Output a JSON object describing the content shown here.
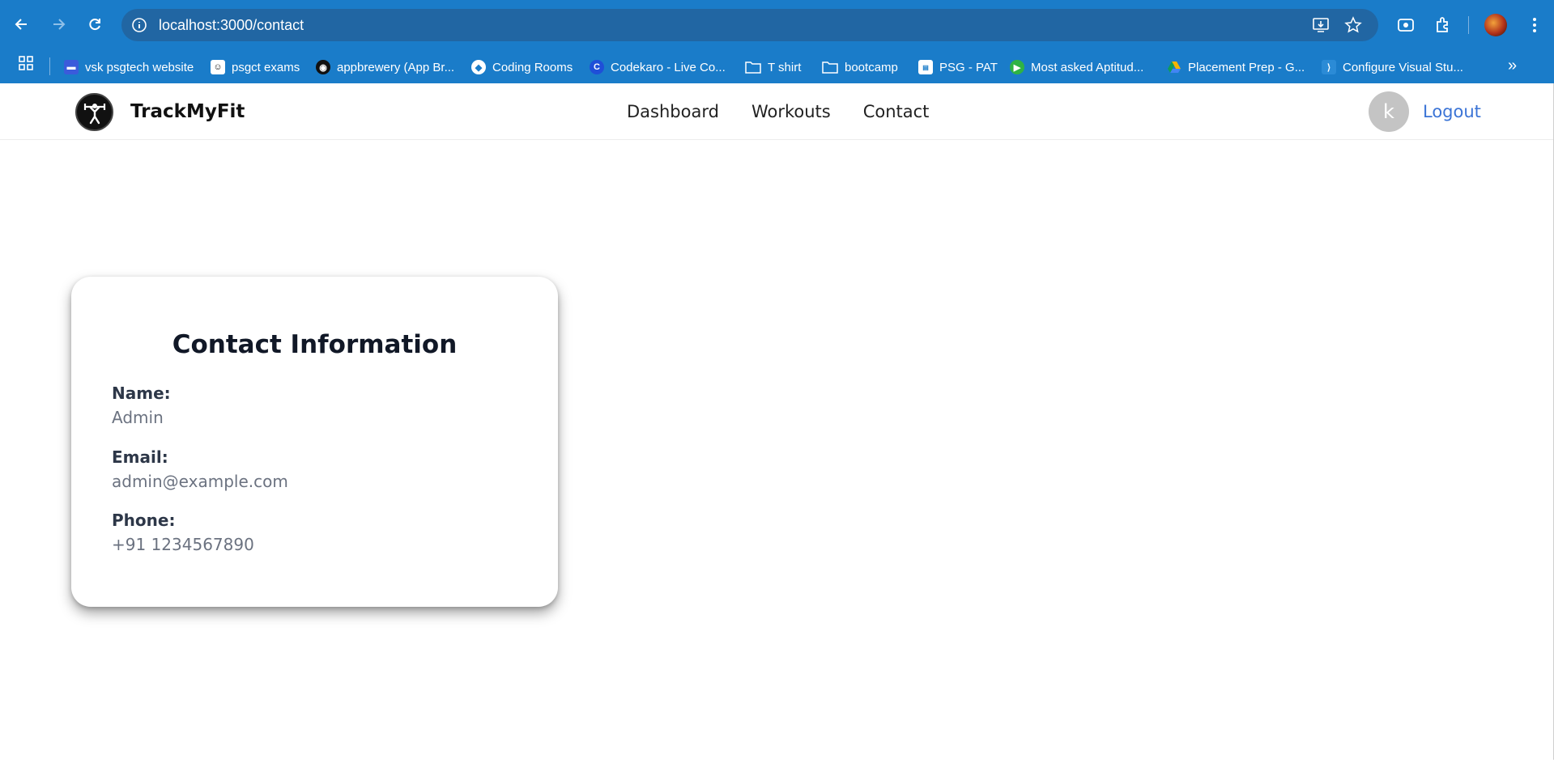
{
  "browser": {
    "url": "localhost:3000/contact",
    "bookmarks": [
      {
        "label": "vsk psgtech website",
        "icon": "tile-icon",
        "color": "#3b5bdb"
      },
      {
        "label": "psgct exams",
        "icon": "person-icon",
        "color": "#ffffff"
      },
      {
        "label": "appbrewery (App Br...",
        "icon": "swirl-icon",
        "color": "#111111"
      },
      {
        "label": "Coding Rooms",
        "icon": "diamond-icon",
        "color": "#ffffff"
      },
      {
        "label": "Codekaro - Live Co...",
        "icon": "c-icon",
        "color": "#1f4fd8"
      },
      {
        "label": "T shirt",
        "icon": "folder-icon",
        "color": ""
      },
      {
        "label": "bootcamp",
        "icon": "folder-icon",
        "color": ""
      },
      {
        "label": "PSG - PAT",
        "icon": "flag-icon",
        "color": "#ffffff"
      },
      {
        "label": "Most asked Aptitud...",
        "icon": "play-icon",
        "color": "#2fb344"
      },
      {
        "label": "Placement Prep - G...",
        "icon": "drive-icon",
        "color": "#f4b400"
      },
      {
        "label": "Configure Visual Stu...",
        "icon": "vscode-icon",
        "color": "#2b8bd6"
      }
    ]
  },
  "app": {
    "brand": "TrackMyFit",
    "nav": [
      "Dashboard",
      "Workouts",
      "Contact"
    ],
    "user_initial": "k",
    "logout_label": "Logout"
  },
  "contact": {
    "title": "Contact Information",
    "name_label": "Name:",
    "name_value": "Admin",
    "email_label": "Email:",
    "email_value": "admin@example.com",
    "phone_label": "Phone:",
    "phone_value": "+91 1234567890"
  },
  "colors": {
    "chrome": "#1a7cc9",
    "accent": "#3b74d6"
  }
}
